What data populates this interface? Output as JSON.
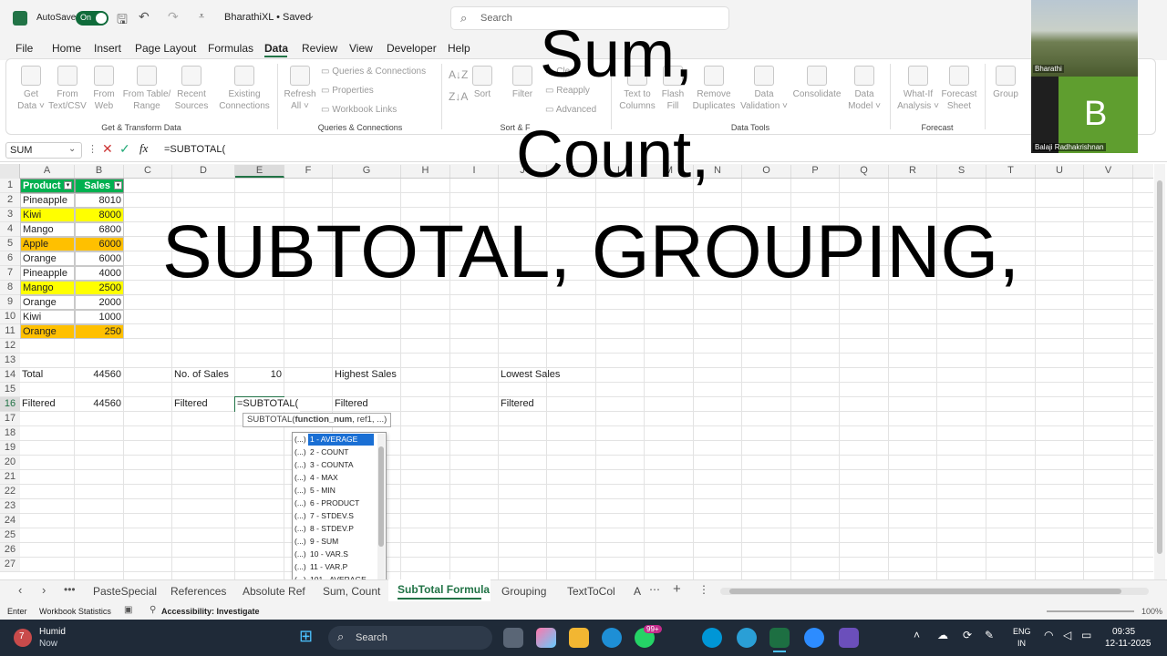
{
  "titlebar": {
    "autosave_label": "AutoSave",
    "autosave_state": "On",
    "doc_title": "BharathiXL • Saved",
    "search_placeholder": "Search"
  },
  "menu": [
    "File",
    "Home",
    "Insert",
    "Page Layout",
    "Formulas",
    "Data",
    "Review",
    "View",
    "Developer",
    "Help"
  ],
  "menu_active": "Data",
  "ribbon": {
    "get_transform": {
      "buttons": [
        "Get\nData ˅",
        "From\nText/CSV",
        "From\nWeb",
        "From Table/\nRange",
        "Recent\nSources",
        "Existing\nConnections"
      ],
      "label": "Get & Transform Data"
    },
    "queries": {
      "buttons": [
        "Refresh\nAll ˅"
      ],
      "small": [
        "Queries & Connections",
        "Properties",
        "Workbook Links"
      ],
      "label": "Queries & Connections"
    },
    "sort_filter": {
      "buttons": [
        "Sort",
        "Filter"
      ],
      "small": [
        "Clear",
        "Reapply",
        "Advanced"
      ],
      "label": "Sort & F"
    },
    "data_tools": {
      "buttons": [
        "Text to\nColumns",
        "Flash\nFill",
        "Remove\nDuplicates",
        "Data\nValidation ˅",
        "Consolidate",
        "Data\nModel ˅"
      ],
      "label": "Data Tools"
    },
    "forecast": {
      "buttons": [
        "What-If\nAnalysis ˅",
        "Forecast\nSheet"
      ],
      "label": "Forecast"
    },
    "outline": {
      "buttons": [
        "Group"
      ]
    }
  },
  "formula_bar": {
    "name_box": "SUM",
    "formula": "=SUBTOTAL("
  },
  "columns": [
    "A",
    "B",
    "C",
    "D",
    "E",
    "F",
    "G",
    "H",
    "I",
    "J",
    "K",
    "L",
    "M",
    "N",
    "O",
    "P",
    "Q",
    "R",
    "S",
    "T",
    "U",
    "V"
  ],
  "rows": [
    "1",
    "2",
    "3",
    "4",
    "5",
    "6",
    "7",
    "8",
    "9",
    "10",
    "11",
    "12",
    "13",
    "14",
    "15",
    "16",
    "17",
    "18",
    "19",
    "20",
    "21",
    "22",
    "23",
    "24",
    "25",
    "26",
    "27"
  ],
  "table": {
    "headers": [
      "Product",
      "Sales"
    ],
    "rows": [
      {
        "product": "Pineapple",
        "sales": "8010",
        "fill": "#ffffff"
      },
      {
        "product": "Kiwi",
        "sales": "8000",
        "fill": "#ffff00"
      },
      {
        "product": "Mango",
        "sales": "6800",
        "fill": "#ffffff"
      },
      {
        "product": "Apple",
        "sales": "6000",
        "fill": "#ffc000"
      },
      {
        "product": "Orange",
        "sales": "6000",
        "fill": "#ffffff"
      },
      {
        "product": "Pineapple",
        "sales": "4000",
        "fill": "#ffffff"
      },
      {
        "product": "Mango",
        "sales": "2500",
        "fill": "#ffff00"
      },
      {
        "product": "Orange",
        "sales": "2000",
        "fill": "#ffffff"
      },
      {
        "product": "Kiwi",
        "sales": "1000",
        "fill": "#ffffff"
      },
      {
        "product": "Orange",
        "sales": "250",
        "fill": "#ffc000"
      }
    ],
    "header_fill": "#00b050"
  },
  "summary": {
    "row14": {
      "a": "Total",
      "b": "44560",
      "d": "No. of Sales",
      "e": "10",
      "g": "Highest Sales",
      "j": "Lowest Sales"
    },
    "row16": {
      "a": "Filtered",
      "b": "44560",
      "d": "Filtered",
      "e": "=SUBTOTAL(",
      "g": "Filtered",
      "j": "Filtered"
    }
  },
  "tooltip": {
    "fn": "SUBTOTAL(",
    "arg_bold": "function_num",
    "rest": ", ref1, ...)"
  },
  "autocomplete": [
    "1 - AVERAGE",
    "2 - COUNT",
    "3 - COUNTA",
    "4 - MAX",
    "5 - MIN",
    "6 - PRODUCT",
    "7 - STDEV.S",
    "8 - STDEV.P",
    "9 - SUM",
    "10 - VAR.S",
    "11 - VAR.P",
    "101 - AVERAGE"
  ],
  "autocomplete_prefix": "(...)",
  "overlay_text": [
    "Sum,",
    "Count,",
    "SUBTOTAL, GROUPING,"
  ],
  "sheet_tabs": [
    "PasteSpecial",
    "References",
    "Absolute Ref",
    "Sum, Count",
    "SubTotal Formula",
    "Grouping",
    "TextToCol",
    "A"
  ],
  "active_sheet": "SubTotal Formula",
  "statusbar": {
    "mode": "Enter",
    "stats": "Workbook Statistics",
    "accessibility": "Accessibility: Investigate",
    "zoom": "100%"
  },
  "video": {
    "top_name": "Bharathi",
    "bottom_name": "Balaji Radhakrishnan",
    "avatar_letter": "B",
    "avatar_color": "#5f9e2f"
  },
  "taskbar": {
    "weather_temp": "7",
    "weather_title": "Humid",
    "weather_sub": "Now",
    "search": "Search",
    "badge": "99+",
    "lang_top": "ENG",
    "lang_bottom": "IN",
    "time": "09:35",
    "date": "12-11-2025"
  }
}
